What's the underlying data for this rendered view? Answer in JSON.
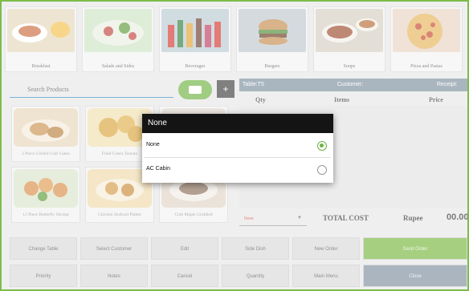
{
  "categories": [
    {
      "label": "Breakfast",
      "bg": "#e4d8ba",
      "accent": "#c96a3e"
    },
    {
      "label": "Salads and Sides",
      "bg": "#cde3c2",
      "accent": "#c0433b"
    },
    {
      "label": "Beverages",
      "bg": "#b9c9d1",
      "accent": "#d5352f"
    },
    {
      "label": "Burgers",
      "bg": "#bfc7ce",
      "accent": "#b27a3e"
    },
    {
      "label": "Soups",
      "bg": "#d4cec2",
      "accent": "#9b4b2a"
    },
    {
      "label": "Pizza and Pastas",
      "bg": "#e9d3c1",
      "accent": "#c5452f"
    }
  ],
  "search": {
    "placeholder": "Search Products"
  },
  "plus_label": "+",
  "products": [
    {
      "label": "2 Piece Grilled Crab Cakes",
      "bg": "#e7d6b8",
      "accent": "#c9924f"
    },
    {
      "label": "Fried Green Tomato",
      "bg": "#f0dfae",
      "accent": "#d9a43a"
    },
    {
      "label": "",
      "bg": "#e3d9cf",
      "accent": "#7a6a5a"
    },
    {
      "label": "12 Piece Butterfly Shrimp",
      "bg": "#dbe4c9",
      "accent": "#d98c45"
    },
    {
      "label": "Chicken Seafood Platter",
      "bg": "#efd9a8",
      "accent": "#d49a45"
    },
    {
      "label": "Crab Maple Griddled",
      "bg": "#e0d4c7",
      "accent": "#8a6d58"
    }
  ],
  "order": {
    "table_label": "Table:T5",
    "customer_label": "Customer:",
    "receipt_label": "Receipt:",
    "col_qty": "Qty",
    "col_items": "Items",
    "col_price": "Price",
    "selector_value": "None",
    "total_label": "TOTAL COST",
    "currency": "Rupee",
    "amount": "00.00"
  },
  "buttons": {
    "change_table": "Change Table",
    "select_customer": "Select Customer",
    "edit": "Edit",
    "side_dish": "Side Dish",
    "new_order": "New Order",
    "send_order": "Send Order",
    "priority": "Priority",
    "notes": "Notes",
    "cancel": "Cancel",
    "quantity": "Quantity",
    "main_menu": "Main Menu",
    "close": "Close"
  },
  "dialog": {
    "title": "None",
    "options": [
      {
        "label": "None",
        "selected": true
      },
      {
        "label": "AC Cabin",
        "selected": false
      }
    ]
  },
  "colors": {
    "accent_green": "#77b53d",
    "header_slate": "#7c8f9f",
    "dialog_title": "#141414"
  }
}
